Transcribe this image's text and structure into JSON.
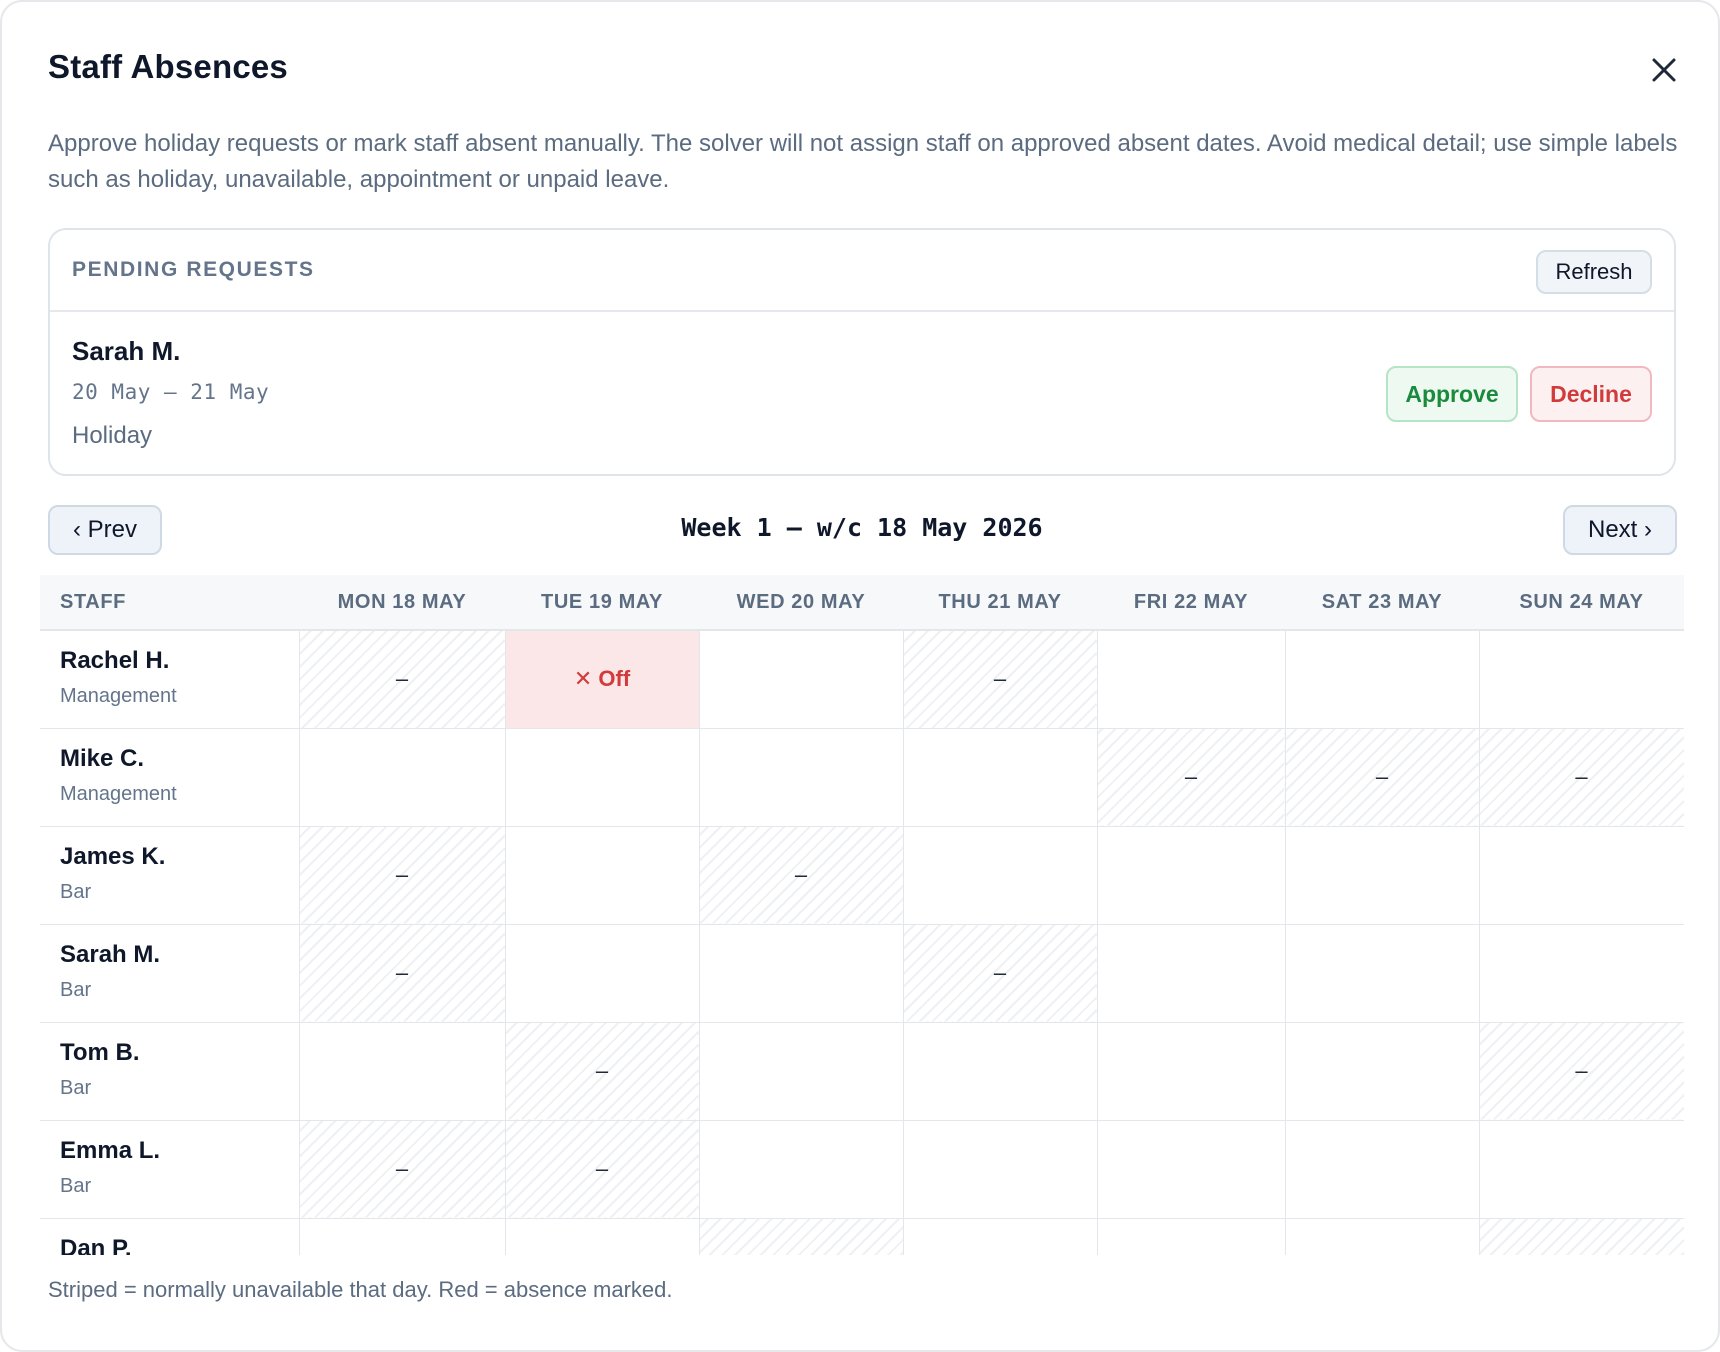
{
  "modal": {
    "title": "Staff Absences",
    "close_icon": "close-icon",
    "intro": "Approve holiday requests or mark staff absent manually. The solver will not assign staff on approved absent dates. Avoid medical detail; use simple labels such as holiday, unavailable, appointment or unpaid leave."
  },
  "pending": {
    "title": "PENDING REQUESTS",
    "refresh_label": "Refresh",
    "requests": [
      {
        "name": "Sarah M.",
        "dates": "20 May – 21 May",
        "type": "Holiday",
        "approve_label": "Approve",
        "decline_label": "Decline"
      }
    ]
  },
  "week_nav": {
    "prev_label": "‹ Prev",
    "title": "Week 1 — w/c 18 May 2026",
    "next_label": "Next ›"
  },
  "grid": {
    "staff_header": "Staff",
    "days": [
      "Mon 18 May",
      "Tue 19 May",
      "Wed 20 May",
      "Thu 21 May",
      "Fri 22 May",
      "Sat 23 May",
      "Sun 24 May"
    ],
    "dash": "–",
    "off_label": "✕ Off",
    "rows": [
      {
        "name": "Rachel H.",
        "role": "Management",
        "cells": [
          "unavail",
          "off",
          "",
          "unavail",
          "",
          "",
          ""
        ]
      },
      {
        "name": "Mike C.",
        "role": "Management",
        "cells": [
          "",
          "",
          "",
          "",
          "unavail",
          "unavail",
          "unavail"
        ]
      },
      {
        "name": "James K.",
        "role": "Bar",
        "cells": [
          "unavail",
          "",
          "unavail",
          "",
          "",
          "",
          ""
        ]
      },
      {
        "name": "Sarah M.",
        "role": "Bar",
        "cells": [
          "unavail",
          "",
          "",
          "unavail",
          "",
          "",
          ""
        ]
      },
      {
        "name": "Tom B.",
        "role": "Bar",
        "cells": [
          "",
          "unavail",
          "",
          "",
          "",
          "",
          "unavail"
        ]
      },
      {
        "name": "Emma L.",
        "role": "Bar",
        "cells": [
          "unavail",
          "unavail",
          "",
          "",
          "",
          "",
          ""
        ]
      },
      {
        "name": "Dan P.",
        "role": "",
        "cells": [
          "",
          "",
          "unavail",
          "",
          "",
          "",
          "unavail"
        ]
      }
    ]
  },
  "footnote": "Striped = normally unavailable that day. Red = absence marked."
}
